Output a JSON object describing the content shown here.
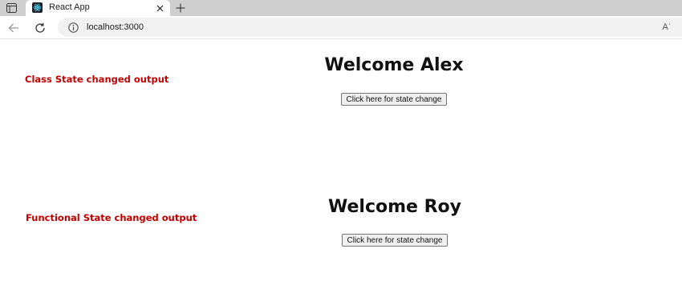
{
  "browser": {
    "tab": {
      "title": "React App"
    },
    "address": {
      "url": "localhost:3000",
      "read_aloud_label": "Aʾ"
    }
  },
  "page": {
    "class_section": {
      "label": "Class State changed output",
      "heading": "Welcome Alex",
      "button_label": "Click here for state change"
    },
    "functional_section": {
      "label": "Functional State changed output",
      "heading": "Welcome Roy",
      "button_label": "Click here for state change"
    }
  },
  "colors": {
    "label_red": "#c00000",
    "tabbar_bg": "#cfcfcf",
    "address_bg": "#f1f1f1"
  },
  "icons": {
    "window": "window-icon",
    "favicon": "react-favicon-icon",
    "close": "close-icon",
    "new_tab": "plus-icon",
    "back": "back-arrow-icon",
    "reload": "reload-icon",
    "info": "info-icon",
    "read_aloud": "read-aloud-icon"
  }
}
